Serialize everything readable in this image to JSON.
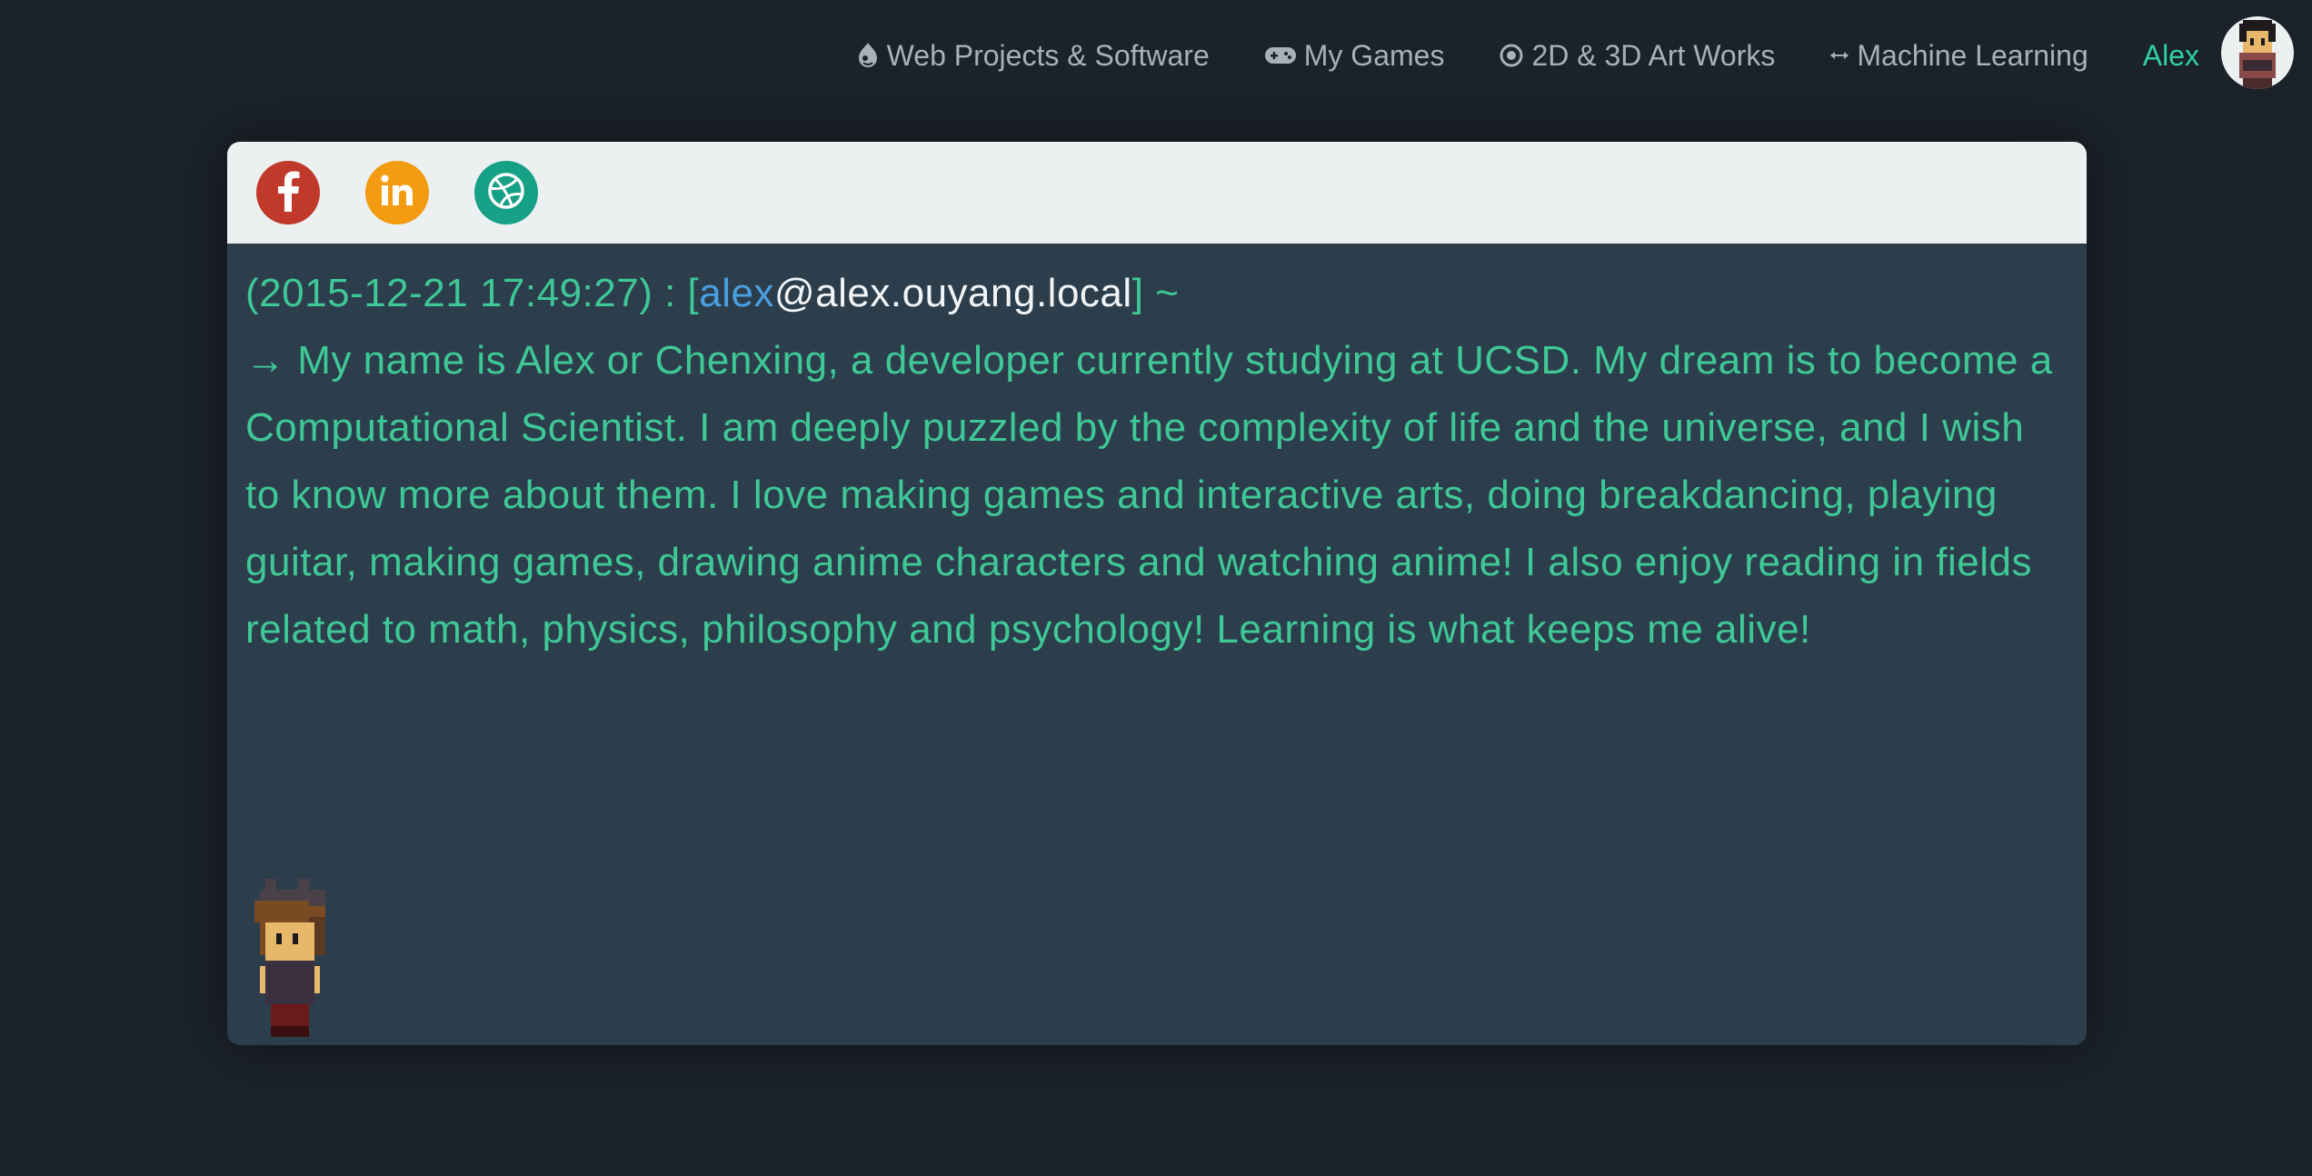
{
  "nav": {
    "items": [
      {
        "label": "Web Projects & Software",
        "icon": "drupal-drop-icon"
      },
      {
        "label": "My Games",
        "icon": "gamepad-icon"
      },
      {
        "label": "2D & 3D Art Works",
        "icon": "target-icon"
      },
      {
        "label": "Machine Learning",
        "icon": "arrows-h-icon"
      }
    ],
    "user": "Alex"
  },
  "social": [
    {
      "name": "facebook",
      "color": "#c0392b"
    },
    {
      "name": "linkedin",
      "color": "#f39c12"
    },
    {
      "name": "dribbble",
      "color": "#16a085"
    }
  ],
  "terminal": {
    "timestamp": "(2015-12-21 17:49:27)",
    "separator": " : [",
    "user": "alex",
    "host": "@alex.ouyang.local",
    "suffix": "] ~",
    "arrow": "→",
    "message": "My name is Alex or Chenxing, a developer currently studying at UCSD. My dream is to become a Computational Scientist. I am deeply puzzled by the complexity of life and the universe, and I wish to know more about them. I love making games and interactive arts, doing breakdancing, playing guitar, making games, drawing anime characters and watching anime! I also enjoy reading in fields related to math, physics, philosophy and psychology! Learning is what keeps me alive!"
  },
  "colors": {
    "background": "#1b2229",
    "panel": "#2c3e4c",
    "header": "#ecf0f1",
    "accent_green": "#3fc896",
    "accent_blue": "#4a9fe0",
    "nav_text": "#a9b0b6",
    "user_name": "#2fd1a0"
  }
}
